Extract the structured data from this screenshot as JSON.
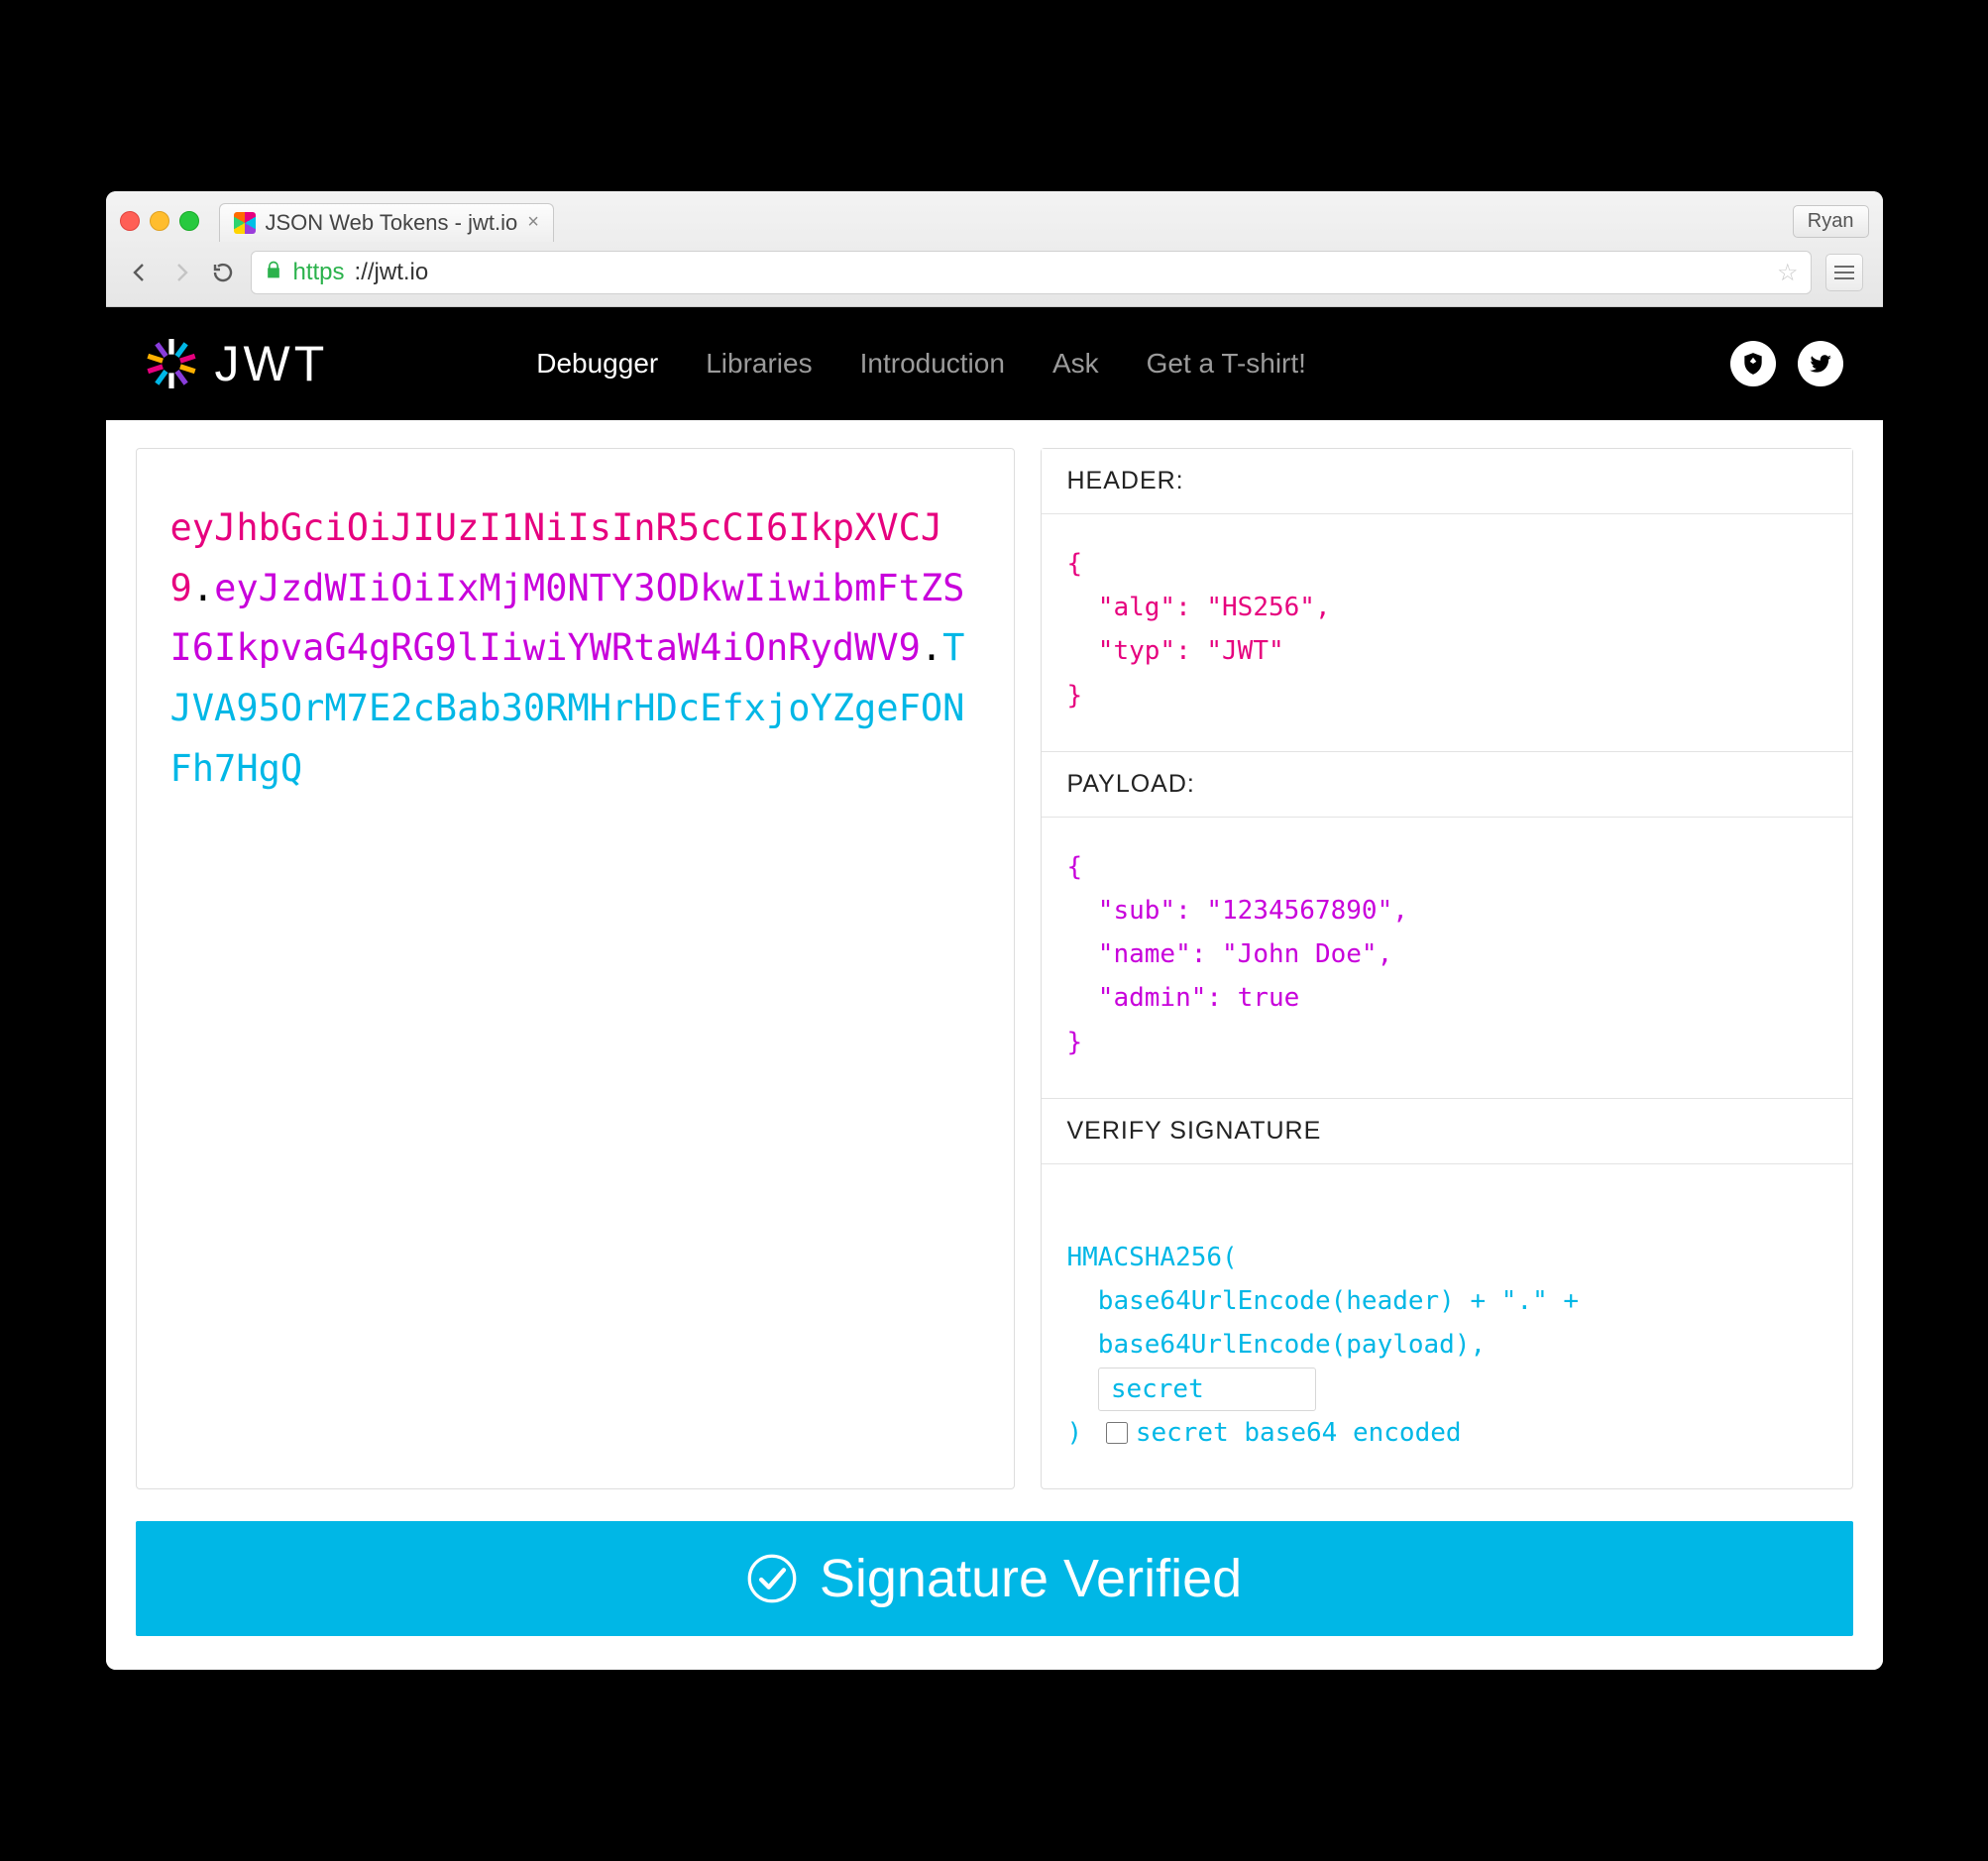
{
  "browser": {
    "tab_title": "JSON Web Tokens - jwt.io",
    "user_chip": "Ryan",
    "url_scheme": "https",
    "url_rest": "://jwt.io"
  },
  "header": {
    "logo_text": "JWT",
    "nav": {
      "debugger": "Debugger",
      "libraries": "Libraries",
      "introduction": "Introduction",
      "ask": "Ask",
      "tshirt": "Get a T-shirt!"
    }
  },
  "token": {
    "header": "eyJhbGciOiJIUzI1NiIsInR5cCI6IkpXVCJ9",
    "payload": "eyJzdWIiOiIxMjM0NTY3ODkwIiwibmFtZSI6IkpvaG4gRG9lIiwiYWRtaW4iOnRydWV9",
    "signature": "TJVA95OrM7E2cBab30RMHrHDcEfxjoYZgeFONFh7HgQ"
  },
  "decoded": {
    "header_title": "HEADER:",
    "header_json": "{\n  \"alg\": \"HS256\",\n  \"typ\": \"JWT\"\n}",
    "payload_title": "PAYLOAD:",
    "payload_json": "{\n  \"sub\": \"1234567890\",\n  \"name\": \"John Doe\",\n  \"admin\": true\n}",
    "signature_title": "VERIFY SIGNATURE",
    "sig_line1": "HMACSHA256(",
    "sig_line2": "  base64UrlEncode(header) + \".\" +",
    "sig_line3": "  base64UrlEncode(payload),",
    "sig_secret_value": "secret",
    "sig_close": ") ",
    "sig_b64_label": "secret base64 encoded"
  },
  "banner": {
    "text": "Signature Verified"
  }
}
